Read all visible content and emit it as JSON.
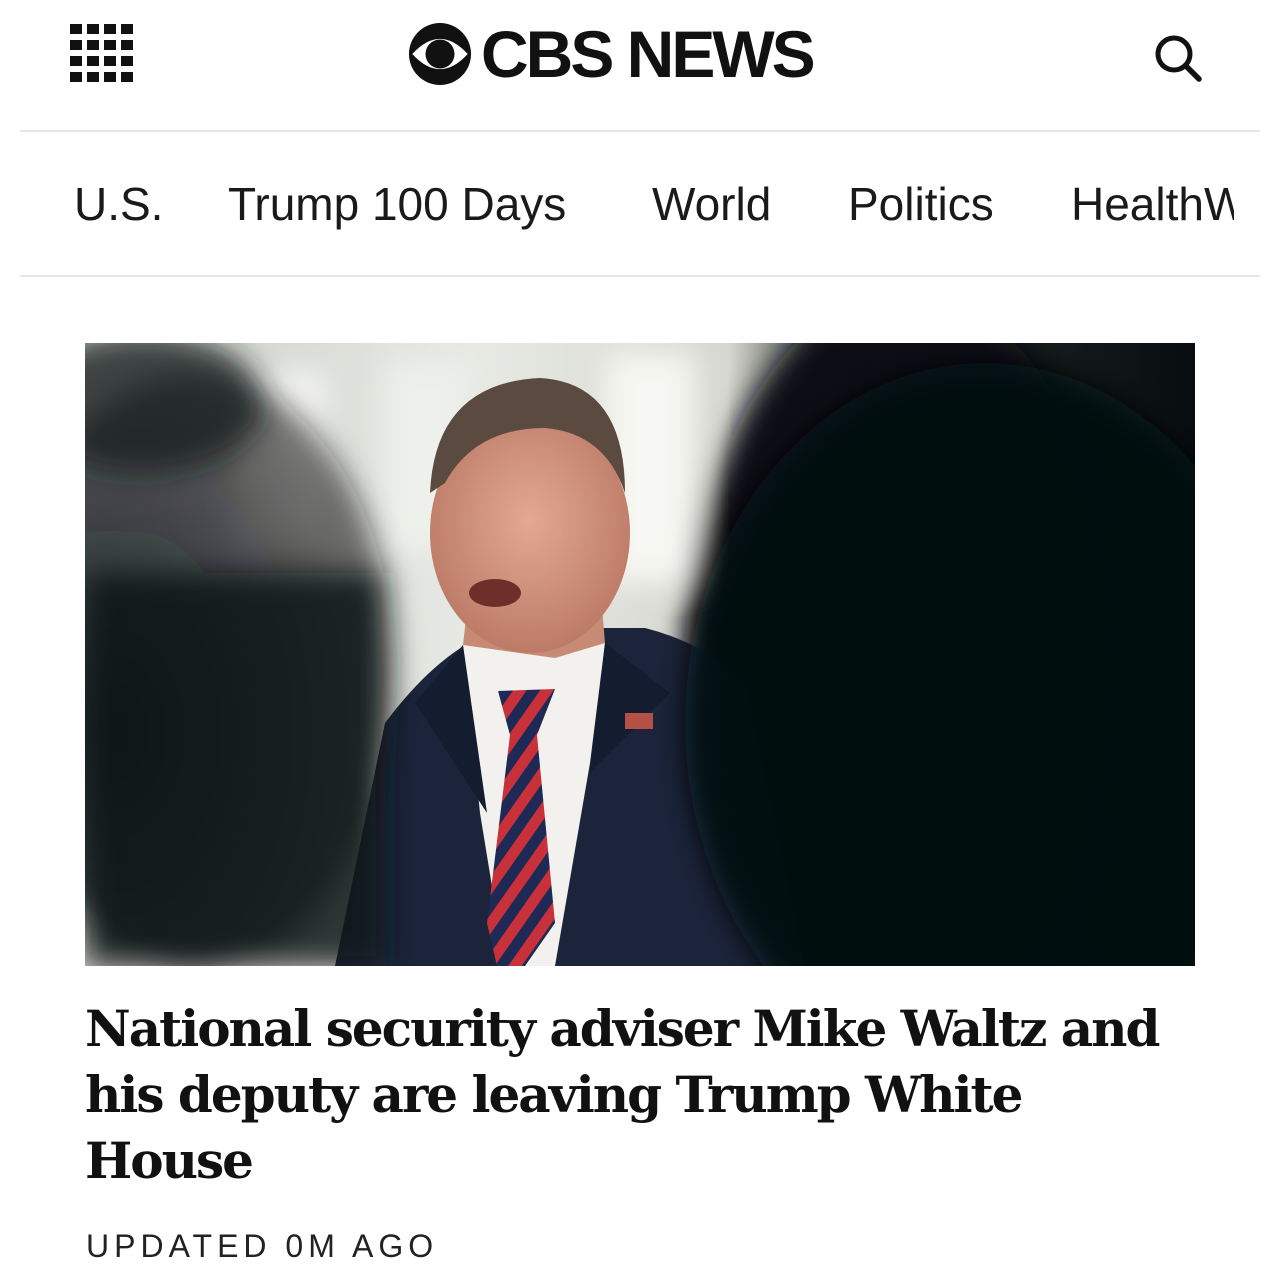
{
  "header": {
    "brand": "CBS NEWS",
    "menu_icon": "grid-menu-icon",
    "search_icon": "search-icon"
  },
  "nav": {
    "items": [
      {
        "label": "U.S."
      },
      {
        "label": "Trump 100 Days"
      },
      {
        "label": "World"
      },
      {
        "label": "Politics"
      },
      {
        "label": "HealthW"
      }
    ]
  },
  "article": {
    "image_alt": "Mike Waltz speaking in a navy suit and red-and-navy striped tie, with a blurred camera in the foreground",
    "headline": "National security adviser Mike Waltz and his deputy are leaving Trump White House",
    "updated": "UPDATED 0M AGO"
  },
  "colors": {
    "text": "#111111",
    "divider": "#e6e6e6",
    "background": "#ffffff"
  }
}
